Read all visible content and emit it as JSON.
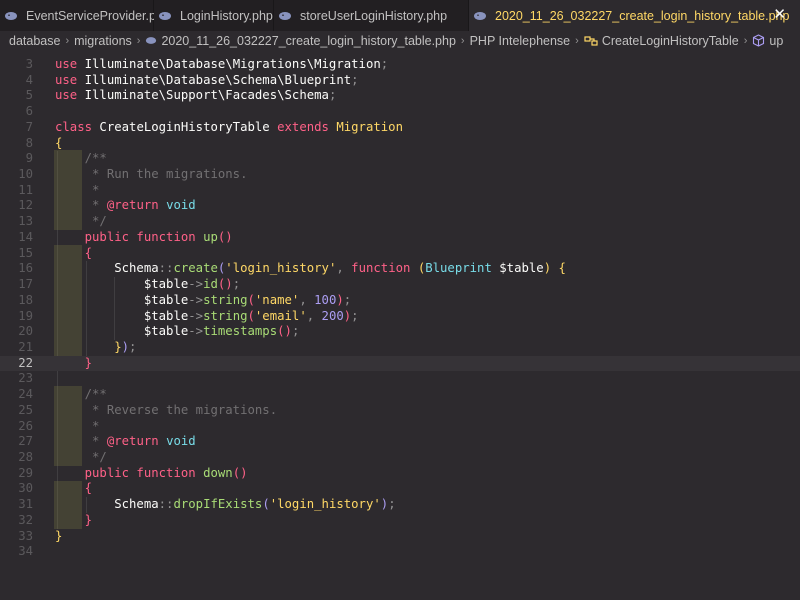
{
  "tabs": [
    {
      "label": "EventServiceProvider.php",
      "active": false
    },
    {
      "label": "LoginHistory.php",
      "active": false
    },
    {
      "label": "storeUserLoginHistory.php",
      "active": false
    },
    {
      "label": "2020_11_26_032227_create_login_history_table.php",
      "active": true
    }
  ],
  "close_glyph": "✕",
  "breadcrumb": {
    "items": [
      "database",
      "migrations",
      "2020_11_26_032227_create_login_history_table.php",
      "PHP Intelephense",
      "CreateLoginHistoryTable",
      "up"
    ],
    "separator": "›"
  },
  "editor": {
    "current_line": 22,
    "lines": [
      {
        "n": "3",
        "tokens": [
          [
            "kw",
            "use "
          ],
          [
            "ns",
            "Illuminate\\Database\\Migrations\\Migration"
          ],
          [
            "punc",
            ";"
          ]
        ]
      },
      {
        "n": "4",
        "tokens": [
          [
            "kw",
            "use "
          ],
          [
            "ns",
            "Illuminate\\Database\\Schema\\Blueprint"
          ],
          [
            "punc",
            ";"
          ]
        ]
      },
      {
        "n": "5",
        "tokens": [
          [
            "kw",
            "use "
          ],
          [
            "ns",
            "Illuminate\\Support\\Facades\\Schema"
          ],
          [
            "punc",
            ";"
          ]
        ]
      },
      {
        "n": "6",
        "tokens": []
      },
      {
        "n": "7",
        "tokens": [
          [
            "kw",
            "class "
          ],
          [
            "cls",
            "CreateLoginHistoryTable "
          ],
          [
            "kw",
            "extends "
          ],
          [
            "str",
            "Migration"
          ]
        ]
      },
      {
        "n": "8",
        "tokens": [
          [
            "b1",
            "{"
          ]
        ]
      },
      {
        "n": "9",
        "tokens": [
          [
            "cmt",
            "    /**"
          ]
        ]
      },
      {
        "n": "10",
        "tokens": [
          [
            "cmt",
            "     * Run the migrations."
          ]
        ]
      },
      {
        "n": "11",
        "tokens": [
          [
            "cmt",
            "     *"
          ]
        ]
      },
      {
        "n": "12",
        "tokens": [
          [
            "cmt",
            "     * "
          ],
          [
            "tag",
            "@return "
          ],
          [
            "type",
            "void"
          ]
        ]
      },
      {
        "n": "13",
        "tokens": [
          [
            "cmt",
            "     */"
          ]
        ]
      },
      {
        "n": "14",
        "tokens": [
          [
            "kw",
            "    public function "
          ],
          [
            "fn",
            "up"
          ],
          [
            "b2",
            "()"
          ]
        ]
      },
      {
        "n": "15",
        "tokens": [
          [
            "b2",
            "    {"
          ]
        ]
      },
      {
        "n": "16",
        "tokens": [
          [
            "ns",
            "        Schema"
          ],
          [
            "punc",
            "::"
          ],
          [
            "fn",
            "create"
          ],
          [
            "b3",
            "("
          ],
          [
            "str",
            "'login_history'"
          ],
          [
            "punc",
            ", "
          ],
          [
            "kw",
            "function "
          ],
          [
            "b1",
            "("
          ],
          [
            "type",
            "Blueprint "
          ],
          [
            "var",
            "$table"
          ],
          [
            "b1",
            ") "
          ],
          [
            "b1",
            "{"
          ]
        ]
      },
      {
        "n": "17",
        "tokens": [
          [
            "var",
            "            $table"
          ],
          [
            "punc",
            "->"
          ],
          [
            "fn",
            "id"
          ],
          [
            "b2",
            "()"
          ],
          [
            "punc",
            ";"
          ]
        ]
      },
      {
        "n": "18",
        "tokens": [
          [
            "var",
            "            $table"
          ],
          [
            "punc",
            "->"
          ],
          [
            "fn",
            "string"
          ],
          [
            "b2",
            "("
          ],
          [
            "str",
            "'name'"
          ],
          [
            "punc",
            ", "
          ],
          [
            "num",
            "100"
          ],
          [
            "b2",
            ")"
          ],
          [
            "punc",
            ";"
          ]
        ]
      },
      {
        "n": "19",
        "tokens": [
          [
            "var",
            "            $table"
          ],
          [
            "punc",
            "->"
          ],
          [
            "fn",
            "string"
          ],
          [
            "b2",
            "("
          ],
          [
            "str",
            "'email'"
          ],
          [
            "punc",
            ", "
          ],
          [
            "num",
            "200"
          ],
          [
            "b2",
            ")"
          ],
          [
            "punc",
            ";"
          ]
        ]
      },
      {
        "n": "20",
        "tokens": [
          [
            "var",
            "            $table"
          ],
          [
            "punc",
            "->"
          ],
          [
            "fn",
            "timestamps"
          ],
          [
            "b2",
            "()"
          ],
          [
            "punc",
            ";"
          ]
        ]
      },
      {
        "n": "21",
        "tokens": [
          [
            "b1",
            "        }"
          ],
          [
            "b3",
            ")"
          ],
          [
            "punc",
            ";"
          ]
        ]
      },
      {
        "n": "22",
        "tokens": [
          [
            "b2",
            "    }"
          ]
        ]
      },
      {
        "n": "23",
        "tokens": []
      },
      {
        "n": "24",
        "tokens": [
          [
            "cmt",
            "    /**"
          ]
        ]
      },
      {
        "n": "25",
        "tokens": [
          [
            "cmt",
            "     * Reverse the migrations."
          ]
        ]
      },
      {
        "n": "26",
        "tokens": [
          [
            "cmt",
            "     *"
          ]
        ]
      },
      {
        "n": "27",
        "tokens": [
          [
            "cmt",
            "     * "
          ],
          [
            "tag",
            "@return "
          ],
          [
            "type",
            "void"
          ]
        ]
      },
      {
        "n": "28",
        "tokens": [
          [
            "cmt",
            "     */"
          ]
        ]
      },
      {
        "n": "29",
        "tokens": [
          [
            "kw",
            "    public function "
          ],
          [
            "fn",
            "down"
          ],
          [
            "b2",
            "()"
          ]
        ]
      },
      {
        "n": "30",
        "tokens": [
          [
            "b2",
            "    {"
          ]
        ]
      },
      {
        "n": "31",
        "tokens": [
          [
            "ns",
            "        Schema"
          ],
          [
            "punc",
            "::"
          ],
          [
            "fn",
            "dropIfExists"
          ],
          [
            "b3",
            "("
          ],
          [
            "str",
            "'login_history'"
          ],
          [
            "b3",
            ")"
          ],
          [
            "punc",
            ";"
          ]
        ]
      },
      {
        "n": "32",
        "tokens": [
          [
            "b2",
            "    }"
          ]
        ]
      },
      {
        "n": "33",
        "tokens": [
          [
            "b1",
            "}"
          ]
        ]
      },
      {
        "n": "34",
        "tokens": []
      }
    ]
  },
  "colors": {
    "background": "#2d2a2e",
    "tabbar": "#221f22",
    "active_tab_text": "#ffd866",
    "keyword": "#ff6188",
    "function": "#a9dc76",
    "string": "#ffd866",
    "number": "#ab9df2",
    "comment": "#727072"
  },
  "icons": {
    "tab_file": "php-elephant-icon",
    "breadcrumb_file": "php-elephant-icon",
    "breadcrumb_class": "class-symbol-icon",
    "breadcrumb_method": "method-cube-icon"
  }
}
